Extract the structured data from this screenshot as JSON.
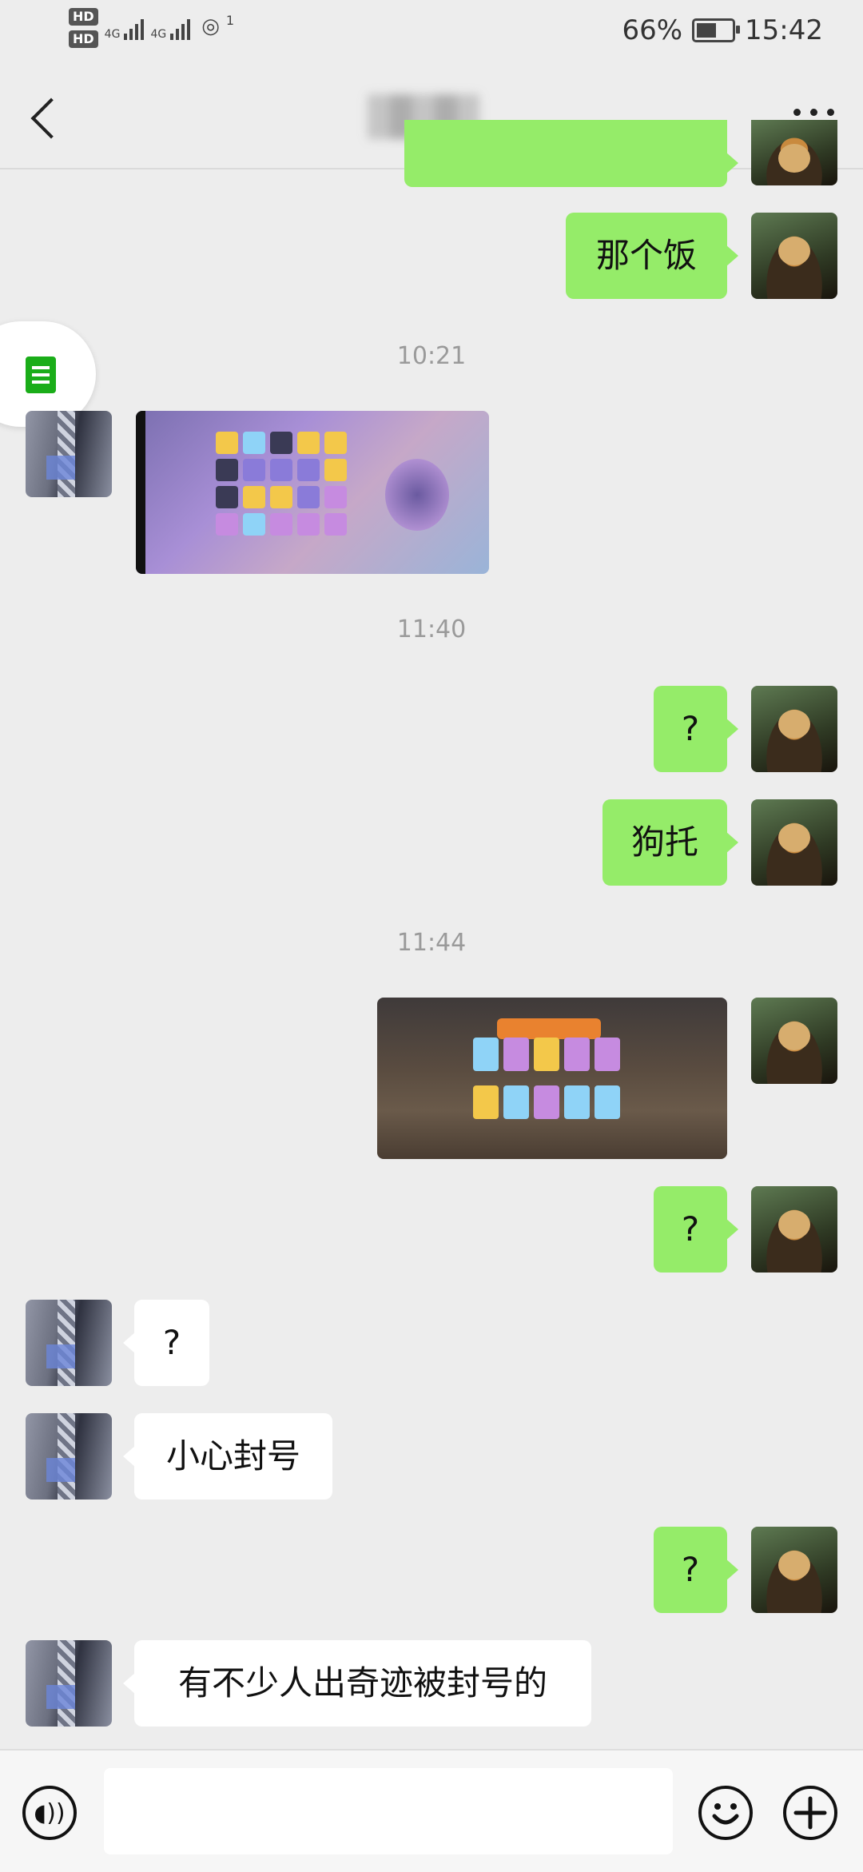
{
  "status_bar": {
    "hd1": "HD",
    "hd2": "HD",
    "net1": "4G",
    "net2": "4G",
    "hotspot_count": "1",
    "battery": "66%",
    "battery_level": 0.66,
    "time": "15:42"
  },
  "header": {
    "title": "",
    "icons": [
      "back-icon",
      "more-icon"
    ]
  },
  "messages": [
    {
      "side": "right",
      "type": "text",
      "text": "那个饭"
    },
    {
      "type": "time",
      "text": "10:21"
    },
    {
      "side": "left",
      "type": "image",
      "alt": "game screenshot"
    },
    {
      "type": "time",
      "text": "11:40"
    },
    {
      "side": "right",
      "type": "text",
      "text": "?"
    },
    {
      "side": "right",
      "type": "text",
      "text": "狗托"
    },
    {
      "type": "time",
      "text": "11:44"
    },
    {
      "side": "right",
      "type": "image",
      "alt": "game screenshot"
    },
    {
      "side": "right",
      "type": "text",
      "text": "?"
    },
    {
      "side": "left",
      "type": "text",
      "text": "?"
    },
    {
      "side": "left",
      "type": "text",
      "text": "小心封号"
    },
    {
      "side": "right",
      "type": "text",
      "text": "?"
    },
    {
      "side": "left",
      "type": "text",
      "text": "有不少人出奇迹被封号的"
    }
  ],
  "input_bar": {
    "value": "",
    "placeholder": "",
    "icons": [
      "voice-icon",
      "emoji-icon",
      "plus-icon"
    ]
  },
  "colors": {
    "chat_bg": "#ededed",
    "bubble_self": "#95ec69",
    "bubble_other": "#ffffff",
    "timestamp": "#9a9a9a"
  }
}
